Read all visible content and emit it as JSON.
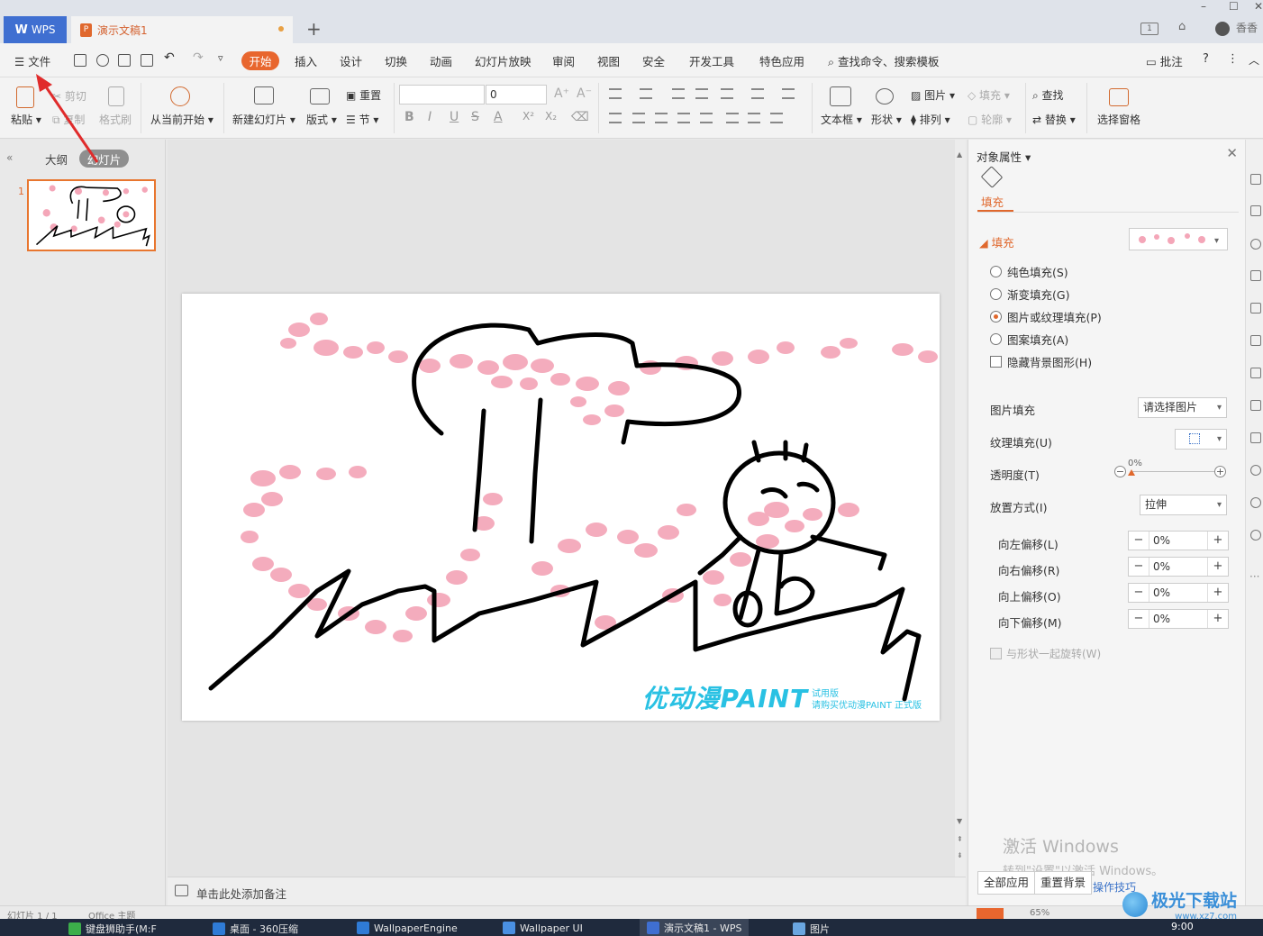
{
  "titlebar": {
    "wps_tab": "WPS",
    "doc_tab": "演示文稿1",
    "user_name": "香香"
  },
  "menubar": {
    "file": "文件",
    "tabs": [
      "开始",
      "插入",
      "设计",
      "切换",
      "动画",
      "幻灯片放映",
      "审阅",
      "视图",
      "安全",
      "开发工具",
      "特色应用"
    ],
    "search": "查找命令、搜索模板",
    "comment": "批注"
  },
  "ribbon": {
    "paste": "粘贴",
    "cut": "剪切",
    "copy": "复制",
    "format_painter": "格式刷",
    "from_current": "从当前开始",
    "new_slide": "新建幻灯片",
    "layout": "版式",
    "reset": "重置",
    "section": "节",
    "font_size": "0",
    "textbox": "文本框",
    "shape": "形状",
    "picture": "图片",
    "fill": "填充",
    "arrange": "排列",
    "outline": "轮廓",
    "find": "查找",
    "replace": "替换",
    "selection_pane": "选择窗格"
  },
  "leftpane": {
    "tab_outline": "大纲",
    "tab_slides": "幻灯片",
    "slide_number": "1"
  },
  "slide": {
    "watermark_logo": "优动漫PAINT",
    "watermark_line1": "试用版",
    "watermark_line2": "请购买优动漫PAINT 正式版"
  },
  "notes": {
    "placeholder": "单击此处添加备注"
  },
  "proppane": {
    "title": "对象属性",
    "fill_tab": "填充",
    "section_fill": "填充",
    "options": [
      "纯色填充(S)",
      "渐变填充(G)",
      "图片或纹理填充(P)",
      "图案填充(A)"
    ],
    "selected_option": "图片或纹理填充(P)",
    "hide_bg": "隐藏背景图形(H)",
    "picture_fill_label": "图片填充",
    "picture_fill_value": "请选择图片",
    "texture_fill_label": "纹理填充(U)",
    "transparency_label": "透明度(T)",
    "transparency_value": "0%",
    "placement_label": "放置方式(I)",
    "placement_value": "拉伸",
    "offsets": [
      {
        "label": "向左偏移(L)",
        "value": "0%"
      },
      {
        "label": "向右偏移(R)",
        "value": "0%"
      },
      {
        "label": "向上偏移(O)",
        "value": "0%"
      },
      {
        "label": "向下偏移(M)",
        "value": "0%"
      }
    ],
    "rotate_with_shape": "与形状一起旋转(W)",
    "apply_all": "全部应用",
    "reset_bg": "重置背景",
    "tips": "操作技巧",
    "activate_title": "激活 Windows",
    "activate_sub": "转到\"设置\"以激活 Windows。"
  },
  "statusbar": {
    "slide_info": "幻灯片 1 / 1",
    "theme": "Office 主题",
    "zoom": "65%"
  },
  "taskbar": {
    "items": [
      "键盘狮助手(M:F",
      "桌面 - 360压缩",
      "WallpaperEngine",
      "Wallpaper UI",
      "演示文稿1 - WPS",
      "图片"
    ],
    "clock": "9:00"
  },
  "site_watermark": {
    "name": "极光下载站",
    "url": "www.xz7.com"
  },
  "colors": {
    "accent": "#e8662e",
    "wps_blue": "#3f6fd1",
    "watermark_cyan": "#29c1e3",
    "petal_pink": "#f4a6b8"
  }
}
